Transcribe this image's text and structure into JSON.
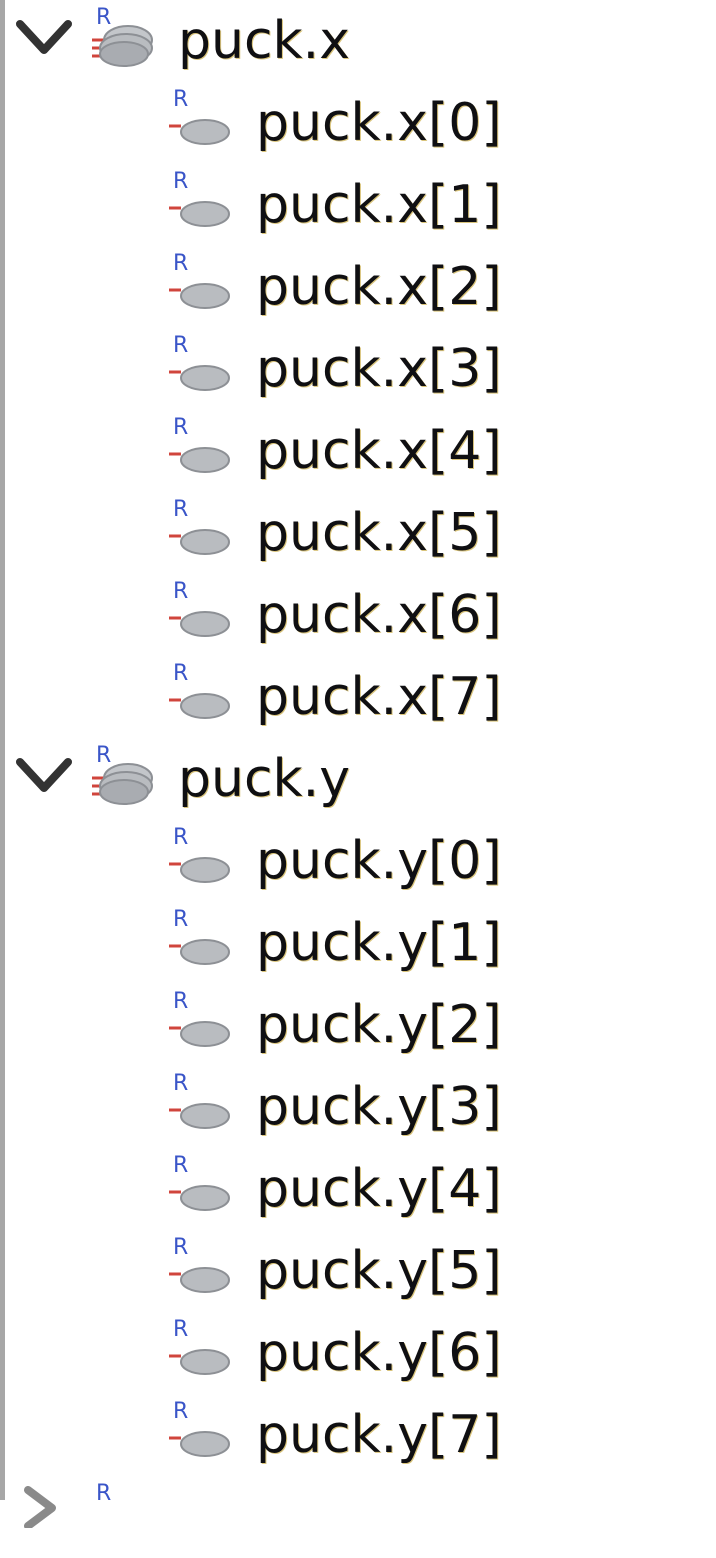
{
  "tree": {
    "groups": [
      {
        "label": "puck.x",
        "expanded": true,
        "icon": "register-array-icon",
        "children": [
          "puck.x[0]",
          "puck.x[1]",
          "puck.x[2]",
          "puck.x[3]",
          "puck.x[4]",
          "puck.x[5]",
          "puck.x[6]",
          "puck.x[7]"
        ]
      },
      {
        "label": "puck.y",
        "expanded": true,
        "icon": "register-array-icon",
        "children": [
          "puck.y[0]",
          "puck.y[1]",
          "puck.y[2]",
          "puck.y[3]",
          "puck.y[4]",
          "puck.y[5]",
          "puck.y[6]",
          "puck.y[7]"
        ]
      },
      {
        "label": "",
        "expanded": false,
        "icon": "register-icon",
        "children": []
      }
    ],
    "child_icon": "register-icon",
    "colors": {
      "text": "#0f0f12",
      "icon_letter": "#3a55c8",
      "icon_accent": "#d0453c",
      "disk": "#b9bcc0",
      "border": "#a7a7a7"
    }
  }
}
